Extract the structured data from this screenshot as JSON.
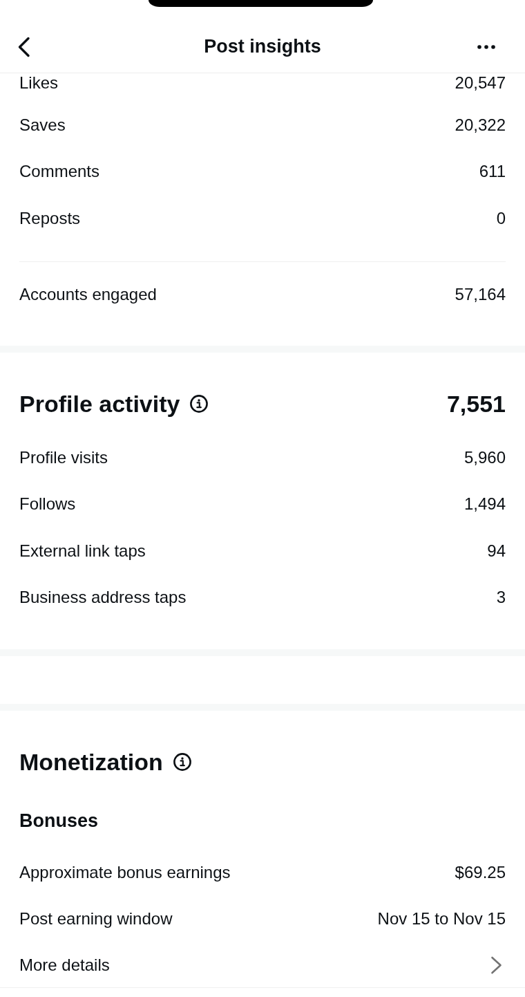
{
  "header": {
    "title": "Post insights"
  },
  "interactions": {
    "rows": [
      {
        "label": "Likes",
        "value": "20,547"
      },
      {
        "label": "Saves",
        "value": "20,322"
      },
      {
        "label": "Comments",
        "value": "611"
      },
      {
        "label": "Reposts",
        "value": "0"
      }
    ],
    "accounts_engaged": {
      "label": "Accounts engaged",
      "value": "57,164"
    }
  },
  "profile_activity": {
    "title": "Profile activity",
    "total": "7,551",
    "rows": [
      {
        "label": "Profile visits",
        "value": "5,960"
      },
      {
        "label": "Follows",
        "value": "1,494"
      },
      {
        "label": "External link taps",
        "value": "94"
      },
      {
        "label": "Business address taps",
        "value": "3"
      }
    ]
  },
  "monetization": {
    "title": "Monetization",
    "bonuses": {
      "title": "Bonuses",
      "rows": [
        {
          "kind": "stat",
          "label": "Approximate bonus earnings",
          "value": "$69.25"
        },
        {
          "kind": "stat",
          "label": "Post earning window",
          "value": "Nov 15 to Nov 15"
        },
        {
          "kind": "link",
          "label": "More details"
        }
      ]
    }
  }
}
